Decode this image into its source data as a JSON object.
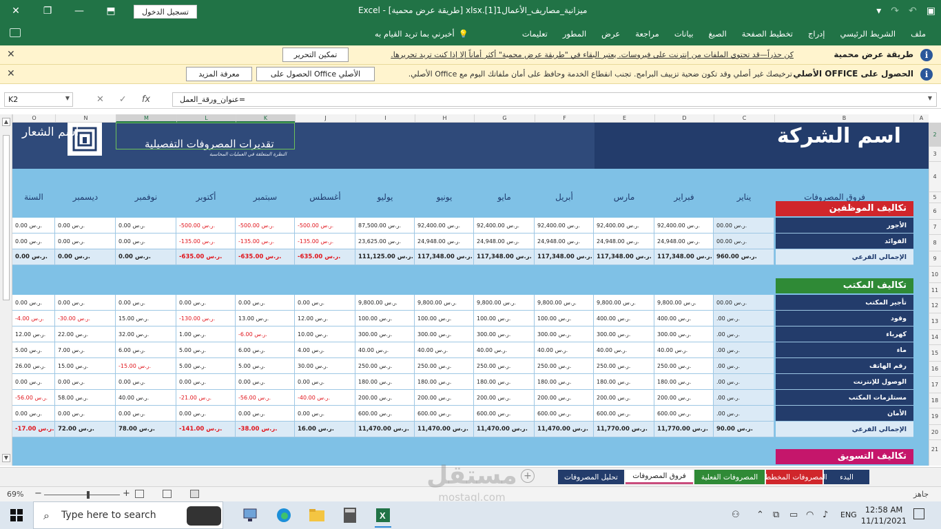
{
  "titlebar": {
    "doc_title": "Excel  -  [طريقة عرض محمية]  xlsx.[1]ميزانية_مصاريف_الأعمال1",
    "signin_label": "تسجيل الدخول"
  },
  "ribbon": {
    "tabs": [
      "ملف",
      "الشريط الرئيسي",
      "إدراج",
      "تخطيط الصفحة",
      "الصيغ",
      "بيانات",
      "مراجعة",
      "عرض",
      "المطور",
      "تعليمات"
    ],
    "tell_me": "أخبرني بما تريد القيام به"
  },
  "msgbar1": {
    "title": "طريقة عرض محمية",
    "text": "كن حذراً—قد تحتوي الملفات من إنترنت على فيروسات. يعتبر البقاء في \"طريقة عرض محمية\" أكثر أماناً إلا إذا كنت تريد تحريرها.",
    "button": "تمكين التحرير"
  },
  "msgbar2": {
    "title": "الحصول على OFFICE الأصلي",
    "text": "ترخيصك غير أصلي وقد تكون ضحية تزييف البرامج. تجنب انقطاع الخدمة وحافظ على أمان ملفاتك اليوم مع Office الأصلي.",
    "button1": "الحصول على Office الأصلي",
    "button2": "معرفة المزيد"
  },
  "formula": {
    "name_box": "K2",
    "content": "=عنوان_ورقة_العمل"
  },
  "columns": [
    "O",
    "N",
    "M",
    "L",
    "K",
    "J",
    "I",
    "H",
    "G",
    "F",
    "E",
    "D",
    "C",
    "B",
    "A"
  ],
  "rows": [
    "2",
    "3",
    "4",
    "5",
    "6",
    "7",
    "8",
    "9",
    "10",
    "11",
    "12",
    "13",
    "14",
    "15",
    "16",
    "17",
    "18",
    "19",
    "20",
    "21"
  ],
  "sheet_header": {
    "company": "اسم الشركة",
    "title": "تقديرات المصروفات التفصيلية",
    "subtitle": "النظرة المتعلقة في العمليات المحاسبة",
    "logo_text": "اسم الشعار"
  },
  "months": [
    "السنة",
    "ديسمبر",
    "نوفمبر",
    "أكتوبر",
    "سبتمبر",
    "أغسطس",
    "يوليو",
    "يونيو",
    "مايو",
    "أبريل",
    "مارس",
    "فبراير",
    "يناير"
  ],
  "diff_label": "فروق المصروفات",
  "sections": [
    {
      "title": "تكاليف الموظفين",
      "color": "#d0262b",
      "rows": [
        {
          "label": "الأجور",
          "values": [
            "0.00 ر.س.",
            "0.00 ر.س.",
            "0.00 ر.س.",
            "-500.00 ر.س.",
            "-500.00 ر.س.",
            "-500.00 ر.س.",
            "87,500.00 ر.س.",
            "92,400.00 ر.س.",
            "92,400.00 ر.س.",
            "92,400.00 ر.س.",
            "92,400.00 ر.س.",
            "92,400.00 ر.س.",
            "00.00 ر.س."
          ]
        },
        {
          "label": "الفوائد",
          "values": [
            "0.00 ر.س.",
            "0.00 ر.س.",
            "0.00 ر.س.",
            "-135.00 ر.س.",
            "-135.00 ر.س.",
            "-135.00 ر.س.",
            "23,625.00 ر.س.",
            "24,948.00 ر.س.",
            "24,948.00 ر.س.",
            "24,948.00 ر.س.",
            "24,948.00 ر.س.",
            "24,948.00 ر.س.",
            "00.00 ر.س."
          ]
        }
      ],
      "total": {
        "label": "الإجمالي الفرعي",
        "values": [
          "0.00 ر.س.",
          "0.00 ر.س.",
          "0.00 ر.س.",
          "-635.00 ر.س.",
          "-635.00 ر.س.",
          "-635.00 ر.س.",
          "111,125.00 ر.س.",
          "117,348.00 ر.س.",
          "117,348.00 ر.س.",
          "117,348.00 ر.س.",
          "117,348.00 ر.س.",
          "117,348.00 ر.س.",
          "960.00 ر.س."
        ]
      }
    },
    {
      "title": "تكاليف المكتب",
      "color": "#2f8a36",
      "rows": [
        {
          "label": "تأجير المكتب",
          "values": [
            "0.00 ر.س.",
            "0.00 ر.س.",
            "0.00 ر.س.",
            "0.00 ر.س.",
            "0.00 ر.س.",
            "0.00 ر.س.",
            "9,800.00 ر.س.",
            "9,800.00 ر.س.",
            "9,800.00 ر.س.",
            "9,800.00 ر.س.",
            "9,800.00 ر.س.",
            "9,800.00 ر.س.",
            "00.00 ر.س."
          ]
        },
        {
          "label": "وقود",
          "values": [
            "-4.00 ر.س.",
            "-30.00 ر.س.",
            "15.00 ر.س.",
            "-130.00 ر.س.",
            "13.00 ر.س.",
            "12.00 ر.س.",
            "100.00 ر.س.",
            "100.00 ر.س.",
            "100.00 ر.س.",
            "100.00 ر.س.",
            "400.00 ر.س.",
            "400.00 ر.س.",
            ".00 ر.س."
          ]
        },
        {
          "label": "كهرباء",
          "values": [
            "12.00 ر.س.",
            "22.00 ر.س.",
            "32.00 ر.س.",
            "1.00 ر.س.",
            "-6.00 ر.س.",
            "10.00 ر.س.",
            "300.00 ر.س.",
            "300.00 ر.س.",
            "300.00 ر.س.",
            "300.00 ر.س.",
            "300.00 ر.س.",
            "300.00 ر.س.",
            ".00 ر.س."
          ]
        },
        {
          "label": "ماء",
          "values": [
            "5.00 ر.س.",
            "7.00 ر.س.",
            "6.00 ر.س.",
            "5.00 ر.س.",
            "6.00 ر.س.",
            "4.00 ر.س.",
            "40.00 ر.س.",
            "40.00 ر.س.",
            "40.00 ر.س.",
            "40.00 ر.س.",
            "40.00 ر.س.",
            "40.00 ر.س.",
            ".00 ر.س."
          ]
        },
        {
          "label": "رقم الهاتف",
          "values": [
            "26.00 ر.س.",
            "15.00 ر.س.",
            "-15.00 ر.س.",
            "5.00 ر.س.",
            "5.00 ر.س.",
            "30.00 ر.س.",
            "250.00 ر.س.",
            "250.00 ر.س.",
            "250.00 ر.س.",
            "250.00 ر.س.",
            "250.00 ر.س.",
            "250.00 ر.س.",
            ".00 ر.س."
          ]
        },
        {
          "label": "الوصول للإنترنت",
          "values": [
            "0.00 ر.س.",
            "0.00 ر.س.",
            "0.00 ر.س.",
            "0.00 ر.س.",
            "0.00 ر.س.",
            "0.00 ر.س.",
            "180.00 ر.س.",
            "180.00 ر.س.",
            "180.00 ر.س.",
            "180.00 ر.س.",
            "180.00 ر.س.",
            "180.00 ر.س.",
            ".00 ر.س."
          ]
        },
        {
          "label": "مستلزمات المكتب",
          "values": [
            "-56.00 ر.س.",
            "58.00 ر.س.",
            "40.00 ر.س.",
            "-21.00 ر.س.",
            "-56.00 ر.س.",
            "-40.00 ر.س.",
            "200.00 ر.س.",
            "200.00 ر.س.",
            "200.00 ر.س.",
            "200.00 ر.س.",
            "200.00 ر.س.",
            "200.00 ر.س.",
            ".00 ر.س."
          ]
        },
        {
          "label": "الأمان",
          "values": [
            "0.00 ر.س.",
            "0.00 ر.س.",
            "0.00 ر.س.",
            "0.00 ر.س.",
            "0.00 ر.س.",
            "0.00 ر.س.",
            "600.00 ر.س.",
            "600.00 ر.س.",
            "600.00 ر.س.",
            "600.00 ر.س.",
            "600.00 ر.س.",
            "600.00 ر.س.",
            ".00 ر.س."
          ]
        }
      ],
      "total": {
        "label": "الإجمالي الفرعي",
        "values": [
          "-17.00 ر.س.",
          "72.00 ر.س.",
          "78.00 ر.س.",
          "-141.00 ر.س.",
          "-38.00 ر.س.",
          "16.00 ر.س.",
          "11,470.00 ر.س.",
          "11,470.00 ر.س.",
          "11,470.00 ر.س.",
          "11,470.00 ر.س.",
          "11,770.00 ر.س.",
          "11,770.00 ر.س.",
          "90.00 ر.س."
        ]
      }
    },
    {
      "title": "تكاليف التسويق",
      "color": "#c5166b",
      "rows": [],
      "total": null
    }
  ],
  "sheet_tabs": [
    {
      "label": "البدء",
      "color": "#233c6b"
    },
    {
      "label": "المصروفات المخططة",
      "color": "#d0262b"
    },
    {
      "label": "المصروفات الفعلية",
      "color": "#2f8a36"
    },
    {
      "label": "فروق المصروفات",
      "color": "#c5166b",
      "active": true
    },
    {
      "label": "تحليل المصروفات",
      "color": "#233c6b"
    }
  ],
  "status": {
    "ready": "جاهز",
    "zoom": "69%"
  },
  "taskbar": {
    "search_placeholder": "Type here to search",
    "time": "12:58 AM",
    "date": "11/11/2021",
    "lang": "ENG"
  },
  "watermark": {
    "ar": "مستقل",
    "en": "mostaql.com"
  }
}
